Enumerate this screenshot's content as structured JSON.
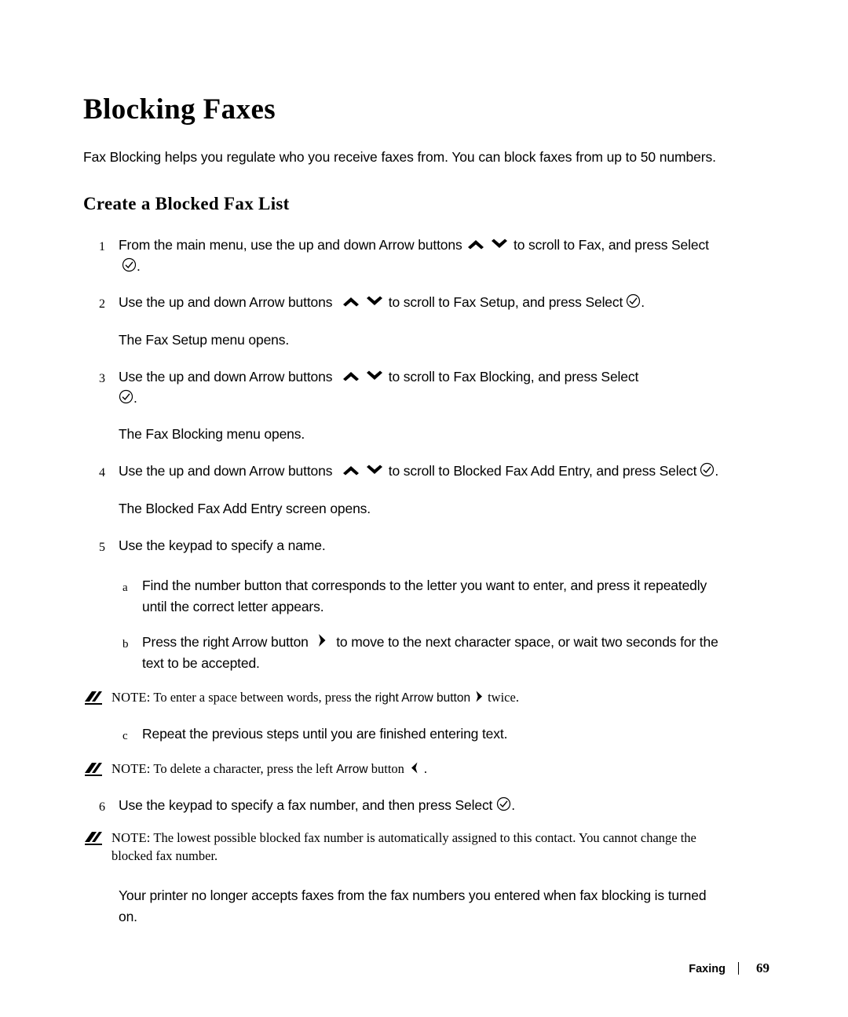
{
  "document": {
    "title": "Blocking Faxes",
    "intro": "Fax Blocking helps you regulate who you receive faxes from. You can block faxes from up to 50 numbers.",
    "subtitle": "Create a Blocked Fax List",
    "steps": [
      {
        "num": "1",
        "parts": {
          "a": "From the main menu, use the up and down Arrow buttons",
          "b": "to scroll to Fax, and press Select",
          "c": "."
        }
      },
      {
        "num": "2",
        "parts": {
          "a": "Use the up and down Arrow buttons",
          "b": "to scroll to Fax Setup, and press Select",
          "c": "."
        },
        "follow": "The Fax Setup menu opens."
      },
      {
        "num": "3",
        "parts": {
          "a": "Use the up and down Arrow buttons",
          "b": "to scroll to Fax Blocking, and press Select",
          "c": "."
        },
        "follow": "The Fax Blocking menu opens."
      },
      {
        "num": "4",
        "parts": {
          "a": "Use the up and down Arrow buttons",
          "b": "to scroll to Blocked Fax Add Entry, and press Select",
          "c": "."
        },
        "follow": "The Blocked Fax Add Entry screen opens."
      },
      {
        "num": "5",
        "parts": {
          "a": "Use the keypad to specify a name."
        }
      }
    ],
    "substeps": [
      {
        "num": "a",
        "text": "Find the number button that corresponds to the letter you want to enter, and press it repeatedly until the correct letter appears."
      },
      {
        "num": "b",
        "text_before": "Press the right Arrow button",
        "text_after": "to move to the next character space, or wait two seconds for the text to be accepted."
      },
      {
        "num": "c",
        "text": "Repeat the previous steps until you are finished entering text."
      }
    ],
    "notes": [
      {
        "label": "NOTE:",
        "before": "To enter a space between words, press",
        "emphasis": "the right Arrow button",
        "after": "twice."
      },
      {
        "label": "NOTE:",
        "before": "To delete a character, press the left",
        "emphasis": "Arrow",
        "after": "button",
        "tail": "."
      },
      {
        "label": "NOTE:",
        "before": "The lowest possible blocked fax number is automatically assigned to this contact. You cannot change the blocked fax number.",
        "emphasis": "",
        "after": ""
      }
    ],
    "step6": {
      "num": "6",
      "before": "Use the keypad to specify a fax number, and then press Select",
      "after": "."
    },
    "closing": "Your printer no longer accepts faxes from the fax numbers you entered when fax blocking is turned on.",
    "footer": {
      "section": "Faxing",
      "page": "69"
    },
    "icons": {
      "up_arrow": "up-arrow-icon",
      "down_arrow": "down-arrow-icon",
      "select": "select-check-icon",
      "right_arrow": "right-arrow-icon",
      "left_arrow": "left-arrow-icon",
      "note": "note-pencil-icon"
    }
  }
}
